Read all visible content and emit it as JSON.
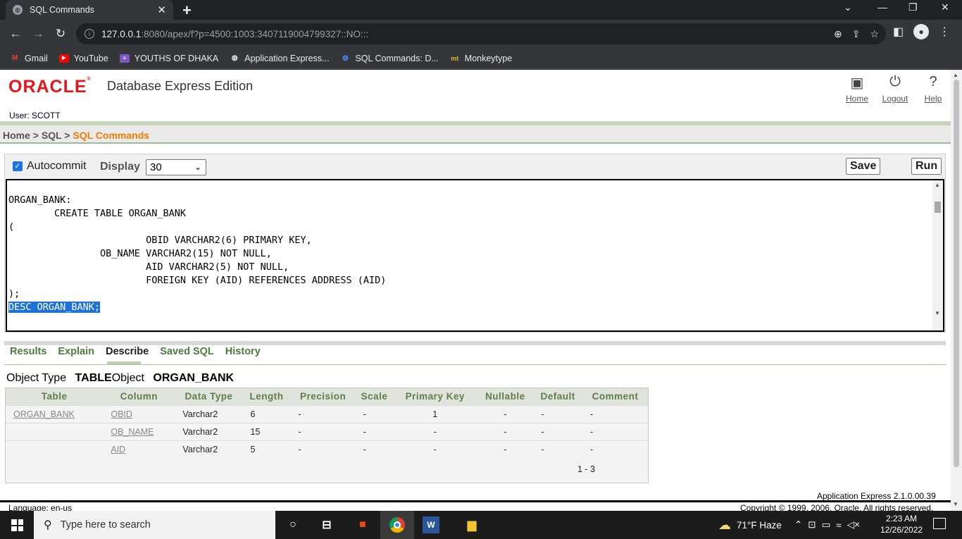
{
  "browser": {
    "tab_title": "SQL Commands",
    "url_host": "127.0.0.1",
    "url_path": ":8080/apex/f?p=4500:1003:3407119004799327::NO:::",
    "bookmarks": [
      {
        "label": "Gmail",
        "icon": "gmail-icon",
        "color": "#ea4335"
      },
      {
        "label": "YouTube",
        "icon": "youtube-icon",
        "color": "#ff0000"
      },
      {
        "label": "YOUTHS OF DHAKA",
        "icon": "bookmark-icon",
        "color": "#7e57c2"
      },
      {
        "label": "Application Express...",
        "icon": "globe-icon",
        "color": "#e8eaed"
      },
      {
        "label": "SQL Commands: D...",
        "icon": "globe-icon",
        "color": "#4285f4"
      },
      {
        "label": "Monkeytype",
        "icon": "monkeytype-icon",
        "color": "#e2b714"
      }
    ]
  },
  "header": {
    "logo": "ORACLE",
    "product": "Database Express Edition",
    "user": "User: SCOTT",
    "links": {
      "home": "Home",
      "logout": "Logout",
      "help": "Help"
    }
  },
  "breadcrumb": {
    "home": "Home",
    "sep": " > ",
    "sql": "SQL",
    "current": "SQL Commands"
  },
  "sql": {
    "autocommit_label": "Autocommit",
    "display_label": "Display",
    "display_value": "30",
    "save_label": "Save",
    "run_label": "Run",
    "editor_text": "ORGAN_BANK:\n        CREATE TABLE ORGAN_BANK\n(\n                        OBID VARCHAR2(6) PRIMARY KEY,\n                OB_NAME VARCHAR2(15) NOT NULL,\n                        AID VARCHAR2(5) NOT NULL,\n                        FOREIGN KEY (AID) REFERENCES ADDRESS (AID)\n);",
    "selected_text": "DESC ORGAN_BANK;"
  },
  "result_tabs": [
    "Results",
    "Explain",
    "Describe",
    "Saved SQL",
    "History"
  ],
  "active_tab": "Describe",
  "object": {
    "type_label": "Object Type",
    "type": "TABLE",
    "object_label": "Object",
    "name": "ORGAN_BANK"
  },
  "describe": {
    "columns": [
      "Table",
      "Column",
      "Data Type",
      "Length",
      "Precision",
      "Scale",
      "Primary Key",
      "Nullable",
      "Default",
      "Comment"
    ],
    "rows": [
      [
        "ORGAN_BANK",
        "OBID",
        "Varchar2",
        "6",
        "-",
        "-",
        "1",
        "-",
        "-",
        "-"
      ],
      [
        "",
        "OB_NAME",
        "Varchar2",
        "15",
        "-",
        "-",
        "-",
        "-",
        "-",
        "-"
      ],
      [
        "",
        "AID",
        "Varchar2",
        "5",
        "-",
        "-",
        "-",
        "-",
        "-",
        "-"
      ]
    ],
    "pager": "1 - 3"
  },
  "footer": {
    "version": "Application Express 2.1.0.00.39",
    "language": "Language: en-us",
    "copyright": "Copyright © 1999, 2006, Oracle. All rights reserved."
  },
  "taskbar": {
    "search_placeholder": "Type here to search",
    "weather": "71°F  Haze",
    "time": "2:23 AM",
    "date": "12/26/2022"
  }
}
